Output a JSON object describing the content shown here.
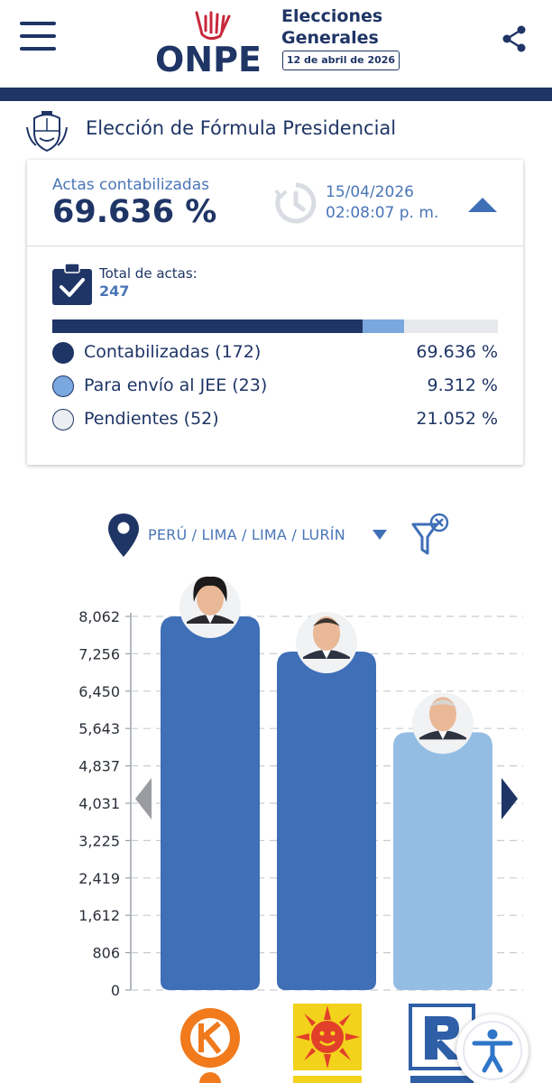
{
  "header": {
    "logo_text": "ONPE",
    "title_line1": "Elecciones",
    "title_line2": "Generales",
    "date_badge": "12 de abril de 2026"
  },
  "section": {
    "title": "Elección de Fórmula Presidencial"
  },
  "summary": {
    "actas_label": "Actas contabilizadas",
    "actas_pct": "69.636 %",
    "date": "15/04/2026",
    "time": "02:08:07 p. m.",
    "total_label": "Total de actas:",
    "total_value": "247",
    "progress": [
      {
        "name": "contabilizadas",
        "pct": 69.636,
        "color": "#1f3566"
      },
      {
        "name": "jee",
        "pct": 9.312,
        "color": "#7aa7dd"
      },
      {
        "name": "pendientes",
        "pct": 21.052,
        "color": "#e8e9ed"
      }
    ],
    "legend": [
      {
        "label": "Contabilizadas (172)",
        "pct": "69.636 %",
        "color": "#1f3566"
      },
      {
        "label": "Para envío al JEE (23)",
        "pct": "9.312 %",
        "color": "#7aa7dd"
      },
      {
        "label": "Pendientes (52)",
        "pct": "21.052 %",
        "color": "#eceef3"
      }
    ]
  },
  "location": {
    "path": "PERÚ / LIMA / LIMA / LURÍN"
  },
  "chart_data": {
    "type": "bar",
    "categories": [
      "",
      "",
      ""
    ],
    "values": [
      8062,
      7303,
      5563
    ],
    "bar_colors": [
      "#3f6fb7",
      "#3f6fb7",
      "#94bde3"
    ],
    "yticks": [
      "8,062",
      "7,256",
      "6,450",
      "5,643",
      "4,837",
      "4,031",
      "3,225",
      "2,419",
      "1,612",
      "806",
      "0"
    ],
    "ylim": [
      0,
      8062
    ],
    "grid": true,
    "xlabel": "",
    "ylabel": ""
  },
  "colors": {
    "navy": "#1f3566",
    "accent": "#4a76b7",
    "bar_dark": "#3f6fb7",
    "bar_light": "#94bde3"
  },
  "icons": [
    "menu-icon",
    "share-icon",
    "peru-shield-icon",
    "clock-icon",
    "check-clipboard-icon",
    "location-pin-icon",
    "filter-clear-icon",
    "chevron-left-icon",
    "chevron-right-icon",
    "accessibility-icon"
  ]
}
